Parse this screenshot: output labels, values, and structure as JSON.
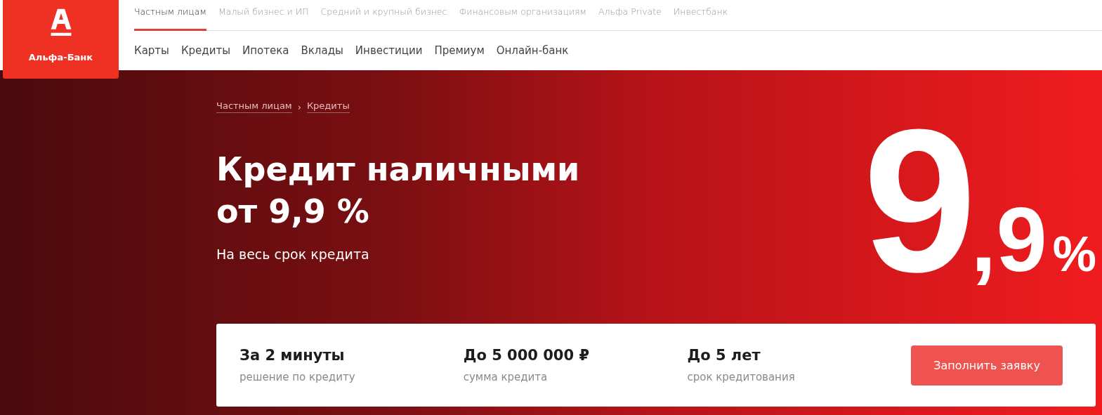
{
  "logo": {
    "name": "Альфа-Банк"
  },
  "segments": [
    {
      "label": "Частным лицам",
      "selected": true
    },
    {
      "label": "Малый бизнес и ИП",
      "selected": false
    },
    {
      "label": "Средний и крупный бизнес",
      "selected": false
    },
    {
      "label": "Финансовым организациям",
      "selected": false
    },
    {
      "label": "Альфа Private",
      "selected": false
    },
    {
      "label": "Инвестбанк",
      "selected": false
    }
  ],
  "menu": [
    "Карты",
    "Кредиты",
    "Ипотека",
    "Вклады",
    "Инвестиции",
    "Премиум",
    "Онлайн-банк"
  ],
  "breadcrumbs": [
    "Частным лицам",
    "Кредиты"
  ],
  "breadcrumb_separator": "›",
  "title_lines": [
    "Кредит наличными",
    "от 9,9 %"
  ],
  "subtitle": "На весь срок кредита",
  "big_rate": {
    "integer": "9",
    "fraction": ",9",
    "unit": "%"
  },
  "features": [
    {
      "value": "За 2 минуты",
      "caption": "решение по кредиту"
    },
    {
      "value": "До 5 000 000 ₽",
      "caption": "сумма кредита"
    },
    {
      "value": "До 5 лет",
      "caption": "срок кредитования"
    }
  ],
  "apply_button": "Заполнить заявку"
}
